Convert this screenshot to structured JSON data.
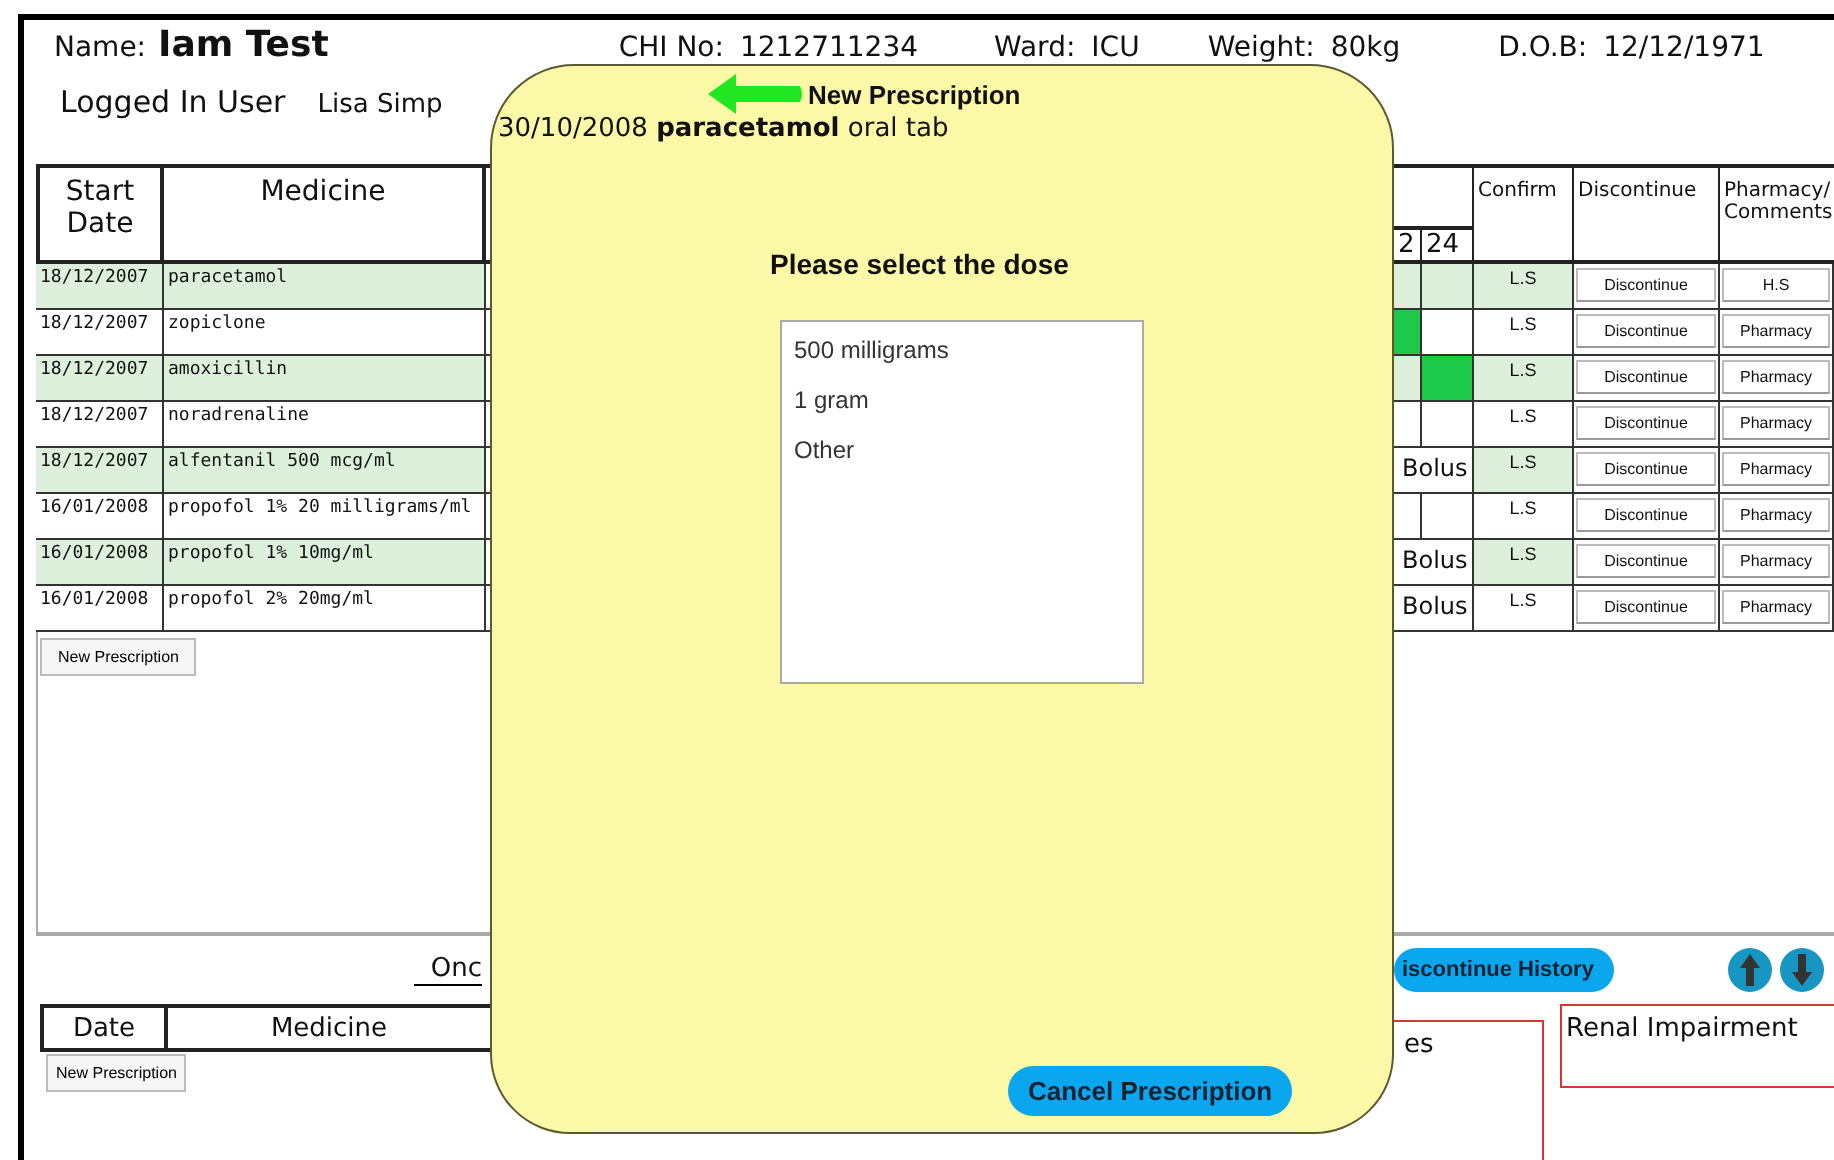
{
  "patient": {
    "name_label": "Name:",
    "name": "Iam Test",
    "chi_label": "CHI No:",
    "chi": "1212711234",
    "ward_label": "Ward:",
    "ward": "ICU",
    "weight_label": "Weight:",
    "weight": "80kg",
    "dob_label": "D.O.B:",
    "dob": "12/12/1971"
  },
  "logged_in": {
    "label": "Logged In User",
    "user": "Lisa Simp"
  },
  "regular_table": {
    "columns": [
      "Start Date",
      "Medicine",
      "2",
      "24",
      "Confirm",
      "Discontinue",
      "Pharmacy/ Comments"
    ],
    "rows": [
      {
        "start_date": "18/12/2007",
        "medicine": "paracetamol",
        "shaded": true,
        "col_2_given": false,
        "col_24_given": false,
        "confirm": "L.S",
        "discontinue": "Discontinue",
        "pharmacy": "H.S"
      },
      {
        "start_date": "18/12/2007",
        "medicine": "zopiclone",
        "shaded": false,
        "col_2_given": true,
        "col_24_given": false,
        "confirm": "L.S",
        "discontinue": "Discontinue",
        "pharmacy": "Pharmacy"
      },
      {
        "start_date": "18/12/2007",
        "medicine": "amoxicillin",
        "shaded": true,
        "col_2_given": false,
        "col_24_given": true,
        "confirm": "L.S",
        "discontinue": "Discontinue",
        "pharmacy": "Pharmacy"
      },
      {
        "start_date": "18/12/2007",
        "medicine": "noradrenaline",
        "shaded": false,
        "col_2_given": false,
        "col_24_given": false,
        "confirm": "L.S",
        "discontinue": "Discontinue",
        "pharmacy": "Pharmacy"
      },
      {
        "start_date": "18/12/2007",
        "medicine": "alfentanil 500 mcg/ml",
        "shaded": true,
        "note": "Bolus",
        "confirm": "L.S",
        "discontinue": "Discontinue",
        "pharmacy": "Pharmacy"
      },
      {
        "start_date": "16/01/2008",
        "medicine": "propofol 1% 20 milligrams/ml",
        "shaded": false,
        "col_2_given": false,
        "col_24_given": false,
        "confirm": "L.S",
        "discontinue": "Discontinue",
        "pharmacy": "Pharmacy"
      },
      {
        "start_date": "16/01/2008",
        "medicine": "propofol 1% 10mg/ml",
        "shaded": true,
        "note": "Bolus",
        "confirm": "L.S",
        "discontinue": "Discontinue",
        "pharmacy": "Pharmacy"
      },
      {
        "start_date": "16/01/2008",
        "medicine": "propofol 2% 20mg/ml",
        "shaded": false,
        "note": "Bolus",
        "confirm": "L.S",
        "discontinue": "Discontinue",
        "pharmacy": "Pharmacy"
      }
    ],
    "new_button": "New Prescription"
  },
  "once_only": {
    "heading": "Onc",
    "discontinue_history": "iscontinue History",
    "columns": [
      "Date",
      "Medicine"
    ],
    "new_button": "New Prescription"
  },
  "notes_box": {
    "heading": "es"
  },
  "renal": {
    "heading": "Renal Impairment"
  },
  "dialog": {
    "title": "New Prescription",
    "drug_line": "30/10/2008 **paracetamol** oral tab",
    "prompt": "Please select the dose",
    "options": [
      {
        "label": "500 milligrams",
        "selected": false
      },
      {
        "label": "1 gram",
        "selected": false
      },
      {
        "label": "Other",
        "selected": false
      }
    ],
    "cancel": "Cancel Prescription"
  }
}
